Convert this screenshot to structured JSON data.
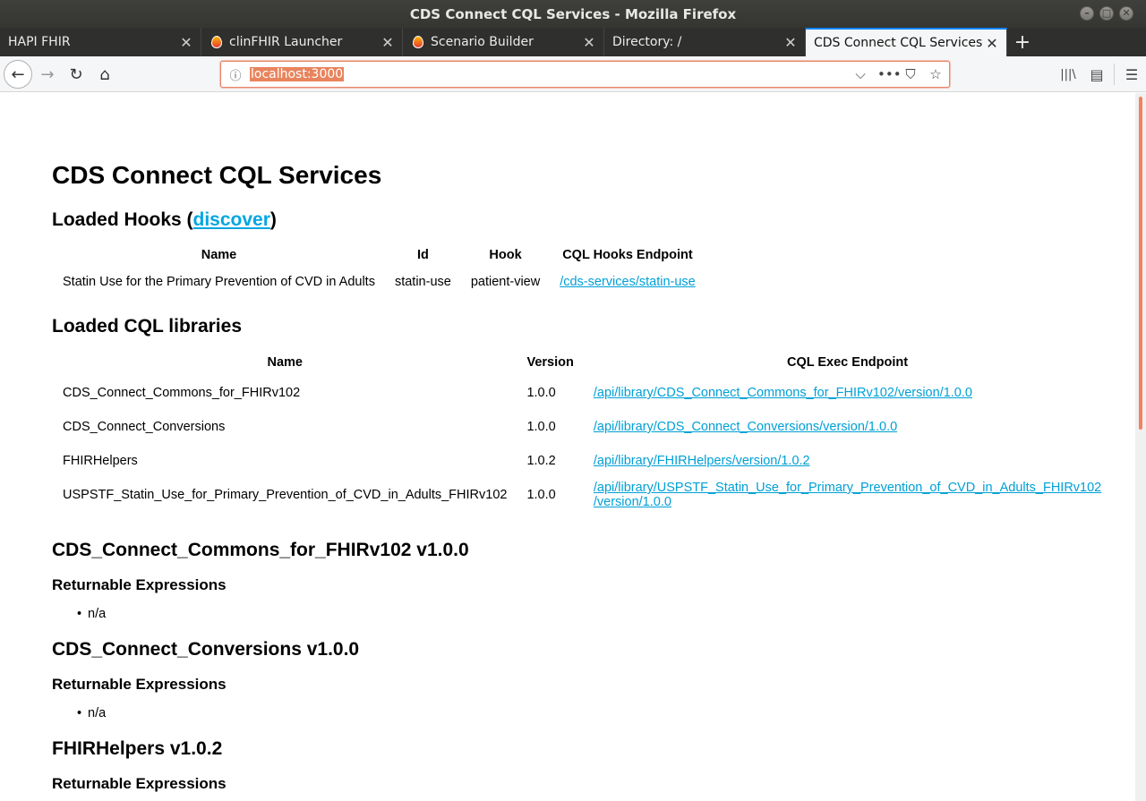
{
  "window": {
    "title": "CDS Connect CQL Services - Mozilla Firefox",
    "controls": {
      "minimize": "–",
      "maximize": "□",
      "close": "✕"
    }
  },
  "tabs": [
    {
      "label": "HAPI FHIR",
      "favicon": "none",
      "active": false
    },
    {
      "label": "clinFHIR Launcher",
      "favicon": "flame-icon",
      "active": false
    },
    {
      "label": "Scenario Builder",
      "favicon": "flame-icon",
      "active": false
    },
    {
      "label": "Directory: /",
      "favicon": "none",
      "active": false
    },
    {
      "label": "CDS Connect CQL Services",
      "favicon": "none",
      "active": true
    }
  ],
  "tab_close_glyph": "✕",
  "new_tab_glyph": "+",
  "navbar": {
    "back_glyph": "←",
    "forward_glyph": "→",
    "reload_glyph": "↻",
    "home_glyph": "⌂",
    "info_glyph": "ⓘ",
    "url": "localhost:3000",
    "dropdown_glyph": "⌵",
    "more_glyph": "•••",
    "pocket_glyph": "⛉",
    "bookmark_glyph": "☆",
    "library_glyph": "|||\\",
    "sidebar_glyph": "▤",
    "menu_glyph": "☰"
  },
  "page": {
    "title": "CDS Connect CQL Services",
    "hooks_heading_prefix": "Loaded Hooks (",
    "hooks_discover_link": "discover",
    "hooks_heading_suffix": ")",
    "hooks_table": {
      "headers": [
        "Name",
        "Id",
        "Hook",
        "CQL Hooks Endpoint"
      ],
      "rows": [
        {
          "name": "Statin Use for the Primary Prevention of CVD in Adults",
          "id": "statin-use",
          "hook": "patient-view",
          "endpoint": "/cds-services/statin-use"
        }
      ]
    },
    "libraries_heading": "Loaded CQL libraries",
    "libraries_table": {
      "headers": [
        "Name",
        "Version",
        "CQL Exec Endpoint"
      ],
      "rows": [
        {
          "name": "CDS_Connect_Commons_for_FHIRv102",
          "version": "1.0.0",
          "endpoint": "/api/library/CDS_Connect_Commons_for_FHIRv102/version/1.0.0"
        },
        {
          "name": "CDS_Connect_Conversions",
          "version": "1.0.0",
          "endpoint": "/api/library/CDS_Connect_Conversions/version/1.0.0"
        },
        {
          "name": "FHIRHelpers",
          "version": "1.0.2",
          "endpoint": "/api/library/FHIRHelpers/version/1.0.2"
        },
        {
          "name": "USPSTF_Statin_Use_for_Primary_Prevention_of_CVD_in_Adults_FHIRv102",
          "version": "1.0.0",
          "endpoint_line1": "/api/library/USPSTF_Statin_Use_for_Primary_Prevention_of_CVD_in_Adults_FHIRv102",
          "endpoint_line2": "/version/1.0.0"
        }
      ]
    },
    "sections": [
      {
        "heading": "CDS_Connect_Commons_for_FHIRv102 v1.0.0",
        "subheading": "Returnable Expressions",
        "items": [
          "n/a"
        ]
      },
      {
        "heading": "CDS_Connect_Conversions v1.0.0",
        "subheading": "Returnable Expressions",
        "items": [
          "n/a"
        ]
      },
      {
        "heading": "FHIRHelpers v1.0.2",
        "subheading": "Returnable Expressions",
        "items": []
      }
    ]
  },
  "colors": {
    "accent_tab": "#0a84ff",
    "link": "#00a0d6",
    "url_highlight": "#e8845d",
    "scroll_thumb": "#f0825f"
  }
}
